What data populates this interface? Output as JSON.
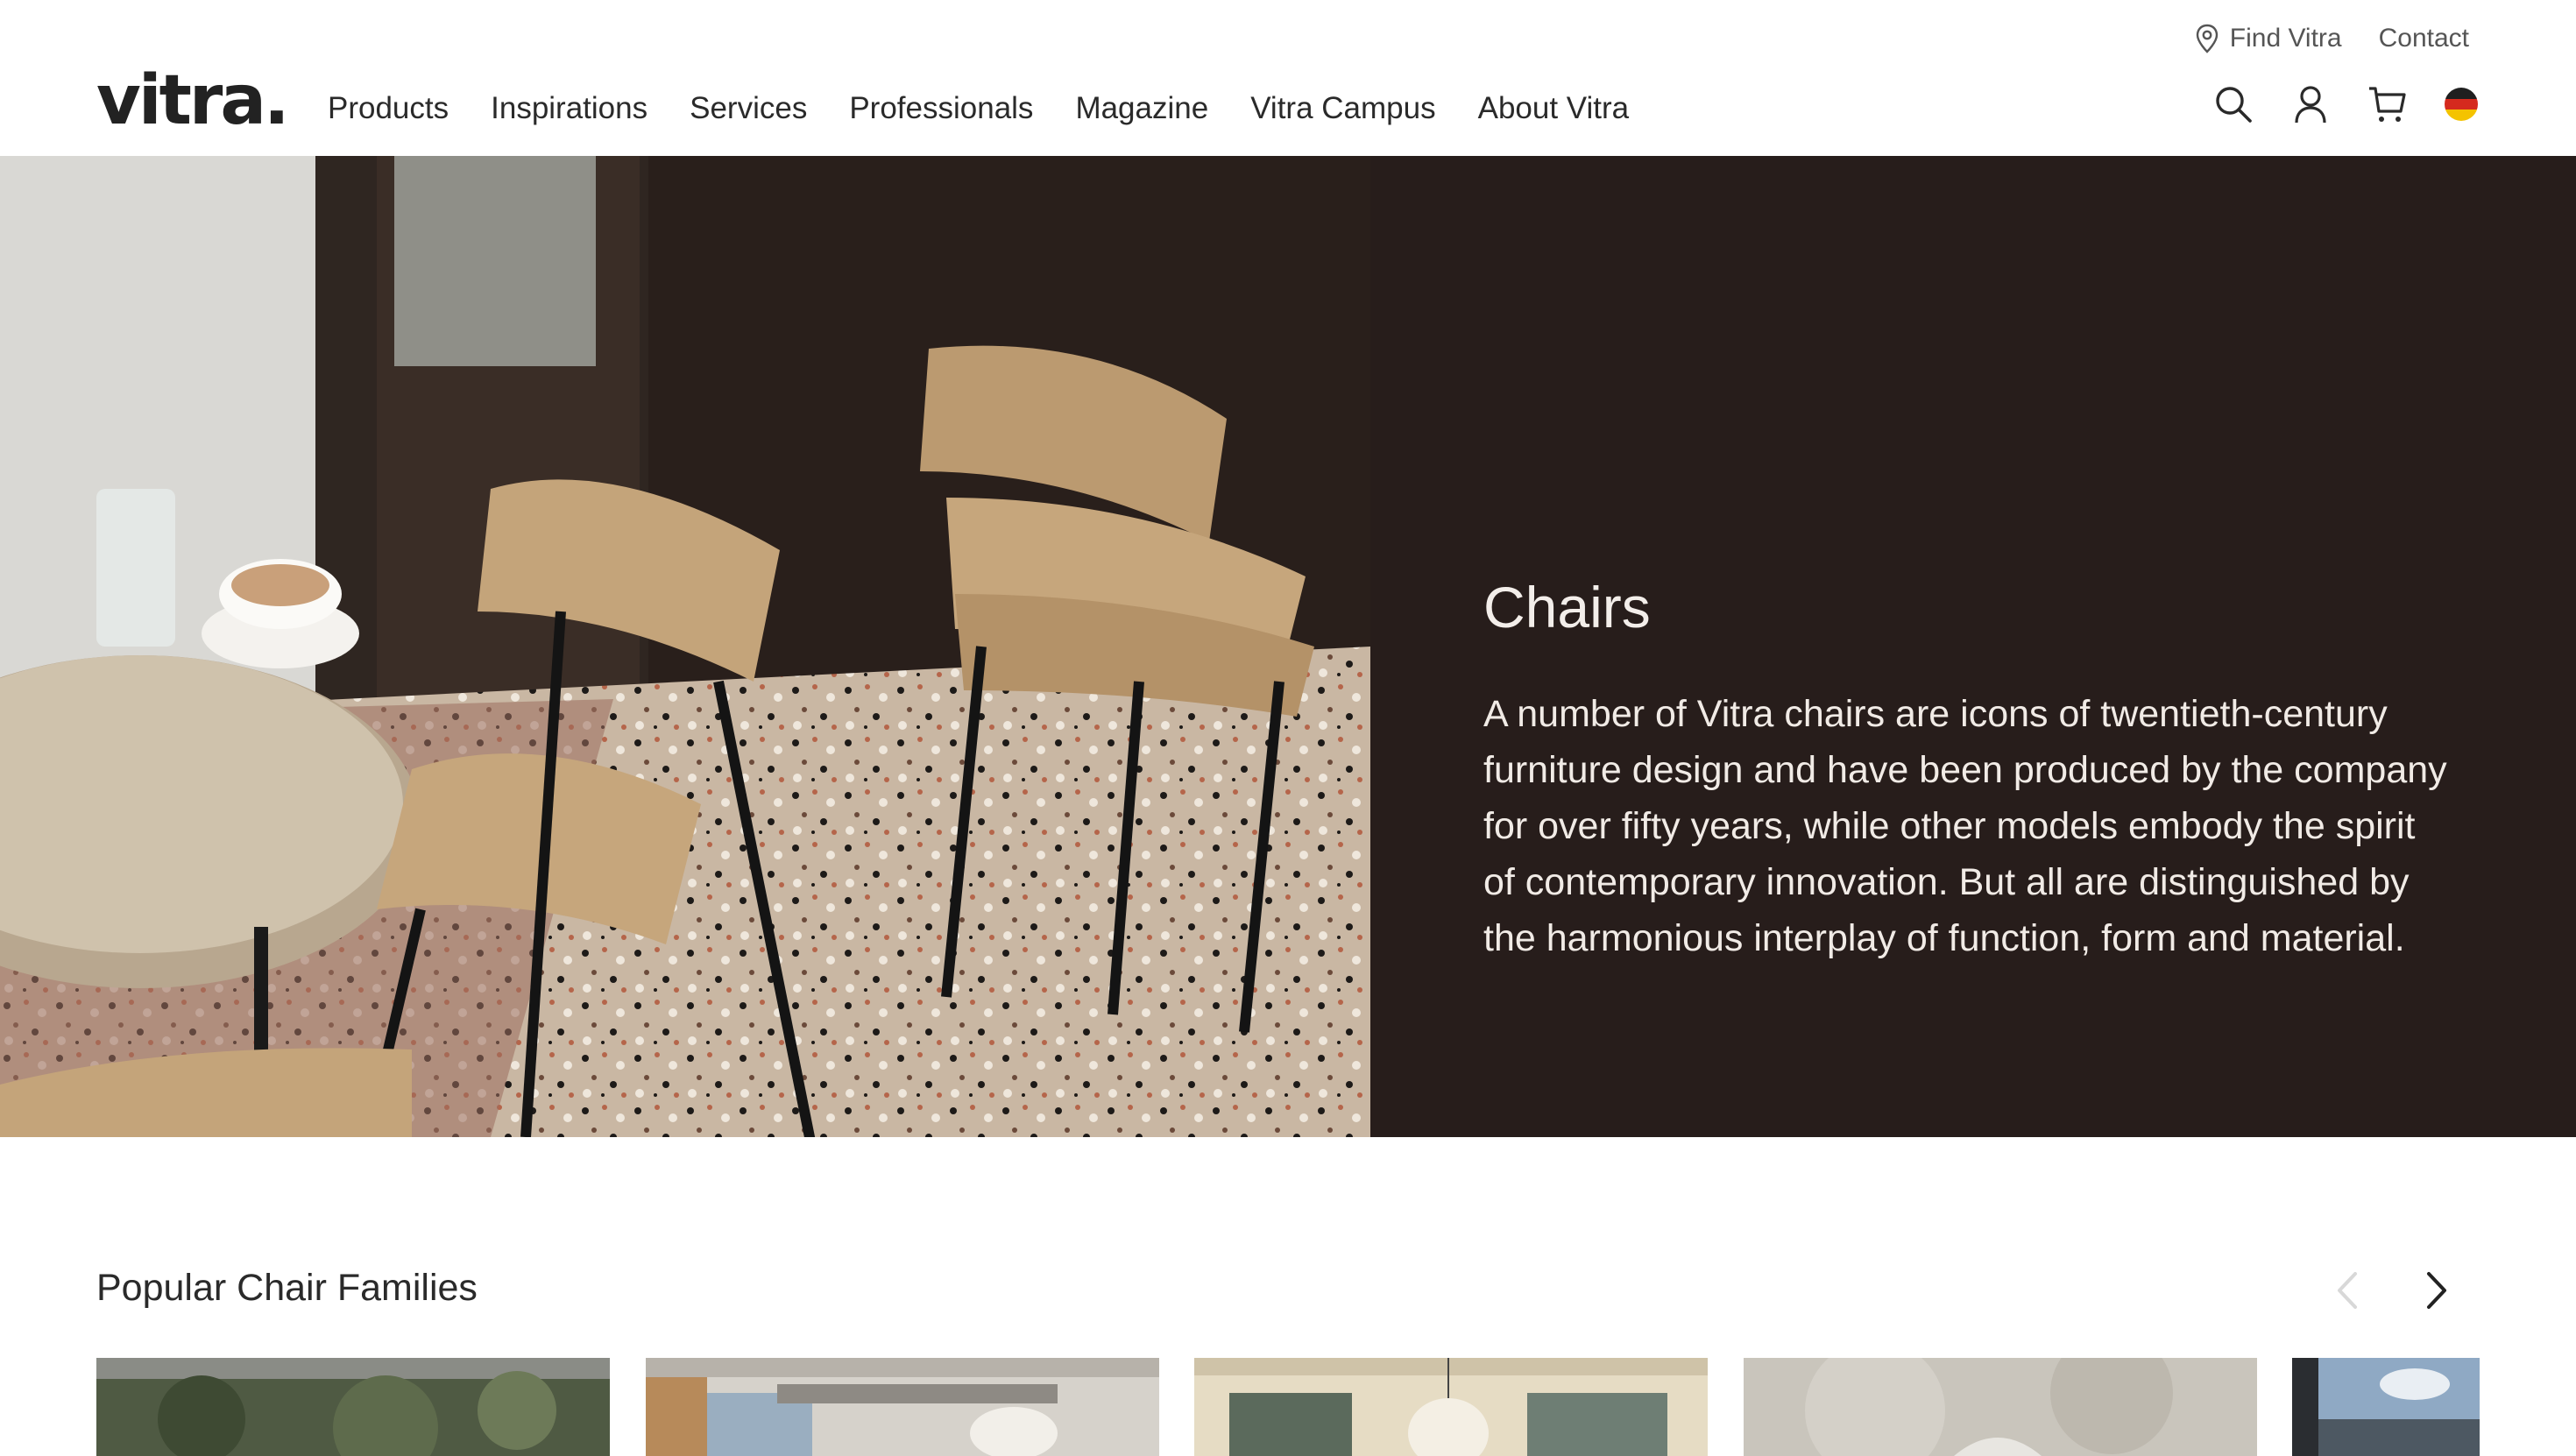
{
  "brand": {
    "logo_text": "vitra."
  },
  "utility_nav": {
    "find_vitra": "Find Vitra",
    "contact": "Contact"
  },
  "main_nav": {
    "items": [
      {
        "label": "Products"
      },
      {
        "label": "Inspirations"
      },
      {
        "label": "Services"
      },
      {
        "label": "Professionals"
      },
      {
        "label": "Magazine"
      },
      {
        "label": "Vitra Campus"
      },
      {
        "label": "About Vitra"
      }
    ]
  },
  "header_actions": {
    "icons": [
      "search-icon",
      "account-icon",
      "cart-icon",
      "language-flag-germany"
    ]
  },
  "hero": {
    "title": "Chairs",
    "description": "A number of Vitra chairs are icons of twentieth-century furniture design and have been produced by the company for over fifty years, while other models embody the spirit of contemporary innovation. But all are distinguished by the harmonious interplay of function, form and material."
  },
  "families": {
    "title": "Popular Chair Families",
    "prev_icon": "chevron-left-icon",
    "next_icon": "chevron-right-icon"
  },
  "colors": {
    "hero_panel": "#271d1b",
    "hero_text": "#f3eeea",
    "text_dark": "#2a2a2a",
    "utility_text": "#555555",
    "flag": [
      "#1f1f1f",
      "#d52a1e",
      "#f4c300"
    ]
  }
}
